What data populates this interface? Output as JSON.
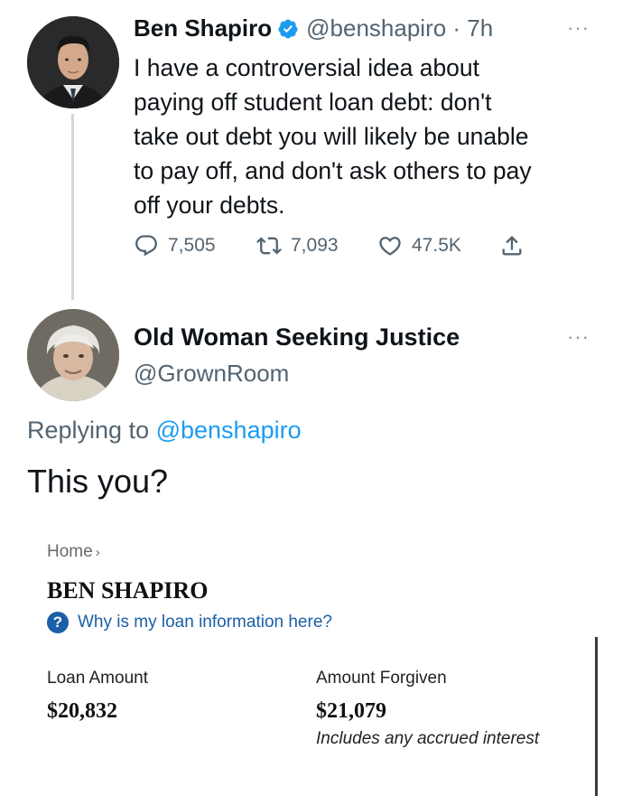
{
  "tweet1": {
    "display_name": "Ben Shapiro",
    "handle": "@benshapiro · 7h",
    "text": "I have a controversial idea about\npaying off student loan debt: don't\ntake out debt you will likely be unable\nto pay off, and don't ask others to pay\noff your debts.",
    "replies": "7,505",
    "retweets": "7,093",
    "likes": "47.5K",
    "more": "···"
  },
  "tweet2": {
    "display_name": "Old Woman Seeking Justice",
    "handle": "@GrownRoom",
    "replying_prefix": "Replying to ",
    "replying_handle": "@benshapiro",
    "text": "This you?",
    "more": "···"
  },
  "loan_page": {
    "breadcrumb": "Home",
    "breadcrumb_sep": "›",
    "name": "BEN SHAPIRO",
    "help_icon": "?",
    "help_link": "Why is my loan information here?",
    "loan_amount_label": "Loan Amount",
    "loan_amount_value": "$20,832",
    "forgiven_label": "Amount Forgiven",
    "forgiven_value": "$21,079",
    "forgiven_note": "Includes any accrued interest"
  },
  "colors": {
    "text": "#0f1419",
    "secondary": "#536471",
    "verified": "#1d9bf0",
    "mention": "#1d9bf0",
    "loan_link": "#1a5fa8"
  },
  "icons": [
    "verified-badge-icon",
    "reply-icon",
    "retweet-icon",
    "like-icon",
    "share-icon",
    "more-icon",
    "help-icon"
  ]
}
